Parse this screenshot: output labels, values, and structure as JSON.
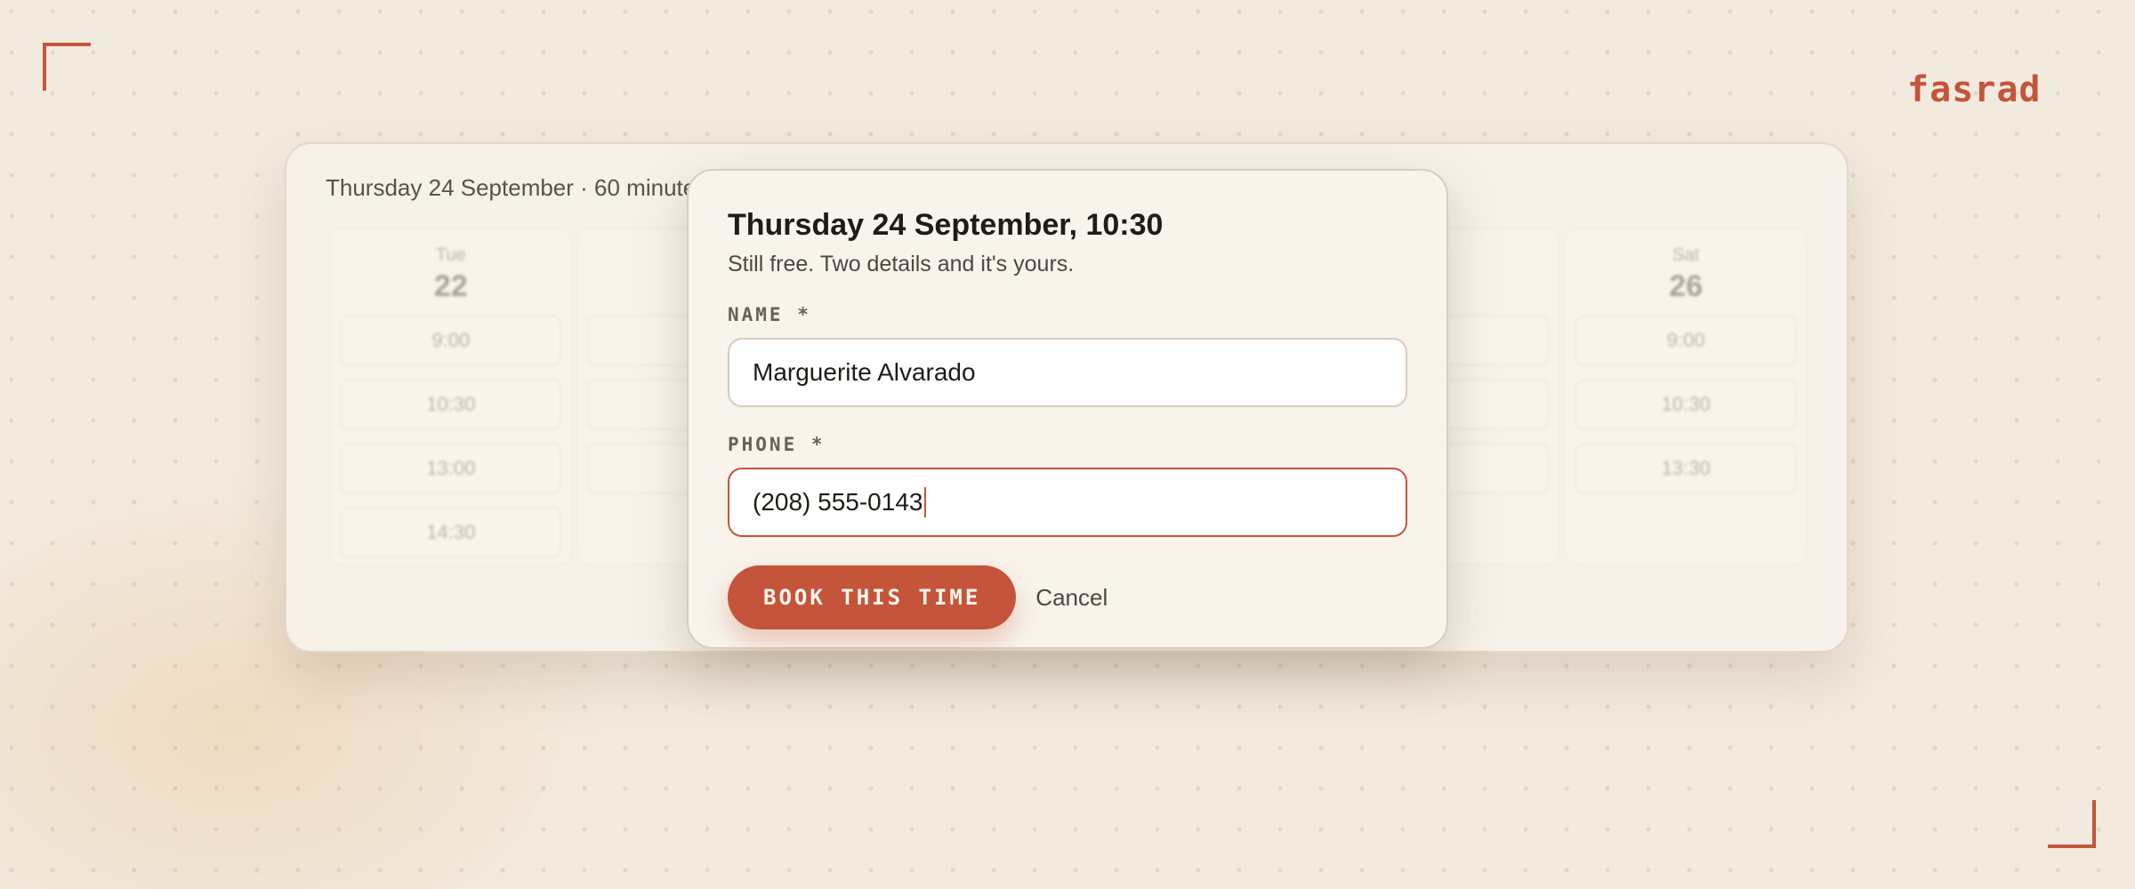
{
  "brand": "fasrad",
  "scheduler": {
    "subtitle": "Thursday 24 September · 60 minute",
    "days": [
      {
        "dow": "Tue",
        "date": "22",
        "slots": [
          "9:00",
          "10:30",
          "13:00",
          "14:30"
        ]
      },
      {
        "dow": "",
        "date": "",
        "slots": [
          "",
          "",
          ""
        ]
      },
      {
        "dow": "",
        "date": "",
        "slots": []
      },
      {
        "dow": "",
        "date": "",
        "slots": []
      },
      {
        "dow": "",
        "date": "",
        "slots": [
          "",
          "",
          ""
        ]
      },
      {
        "dow": "Sat",
        "date": "26",
        "slots": [
          "9:00",
          "10:30",
          "13:30"
        ]
      }
    ]
  },
  "dialog": {
    "title": "Thursday 24 September, 10:30",
    "subtitle": "Still free. Two details and it's yours.",
    "name_label": "NAME *",
    "name_value": "Marguerite Alvarado",
    "phone_label": "PHONE *",
    "phone_value": "(208) 555-0143",
    "book_label": "BOOK THIS TIME",
    "cancel_label": "Cancel"
  },
  "colors": {
    "accent": "#c4553a",
    "background": "#f2eadf"
  }
}
